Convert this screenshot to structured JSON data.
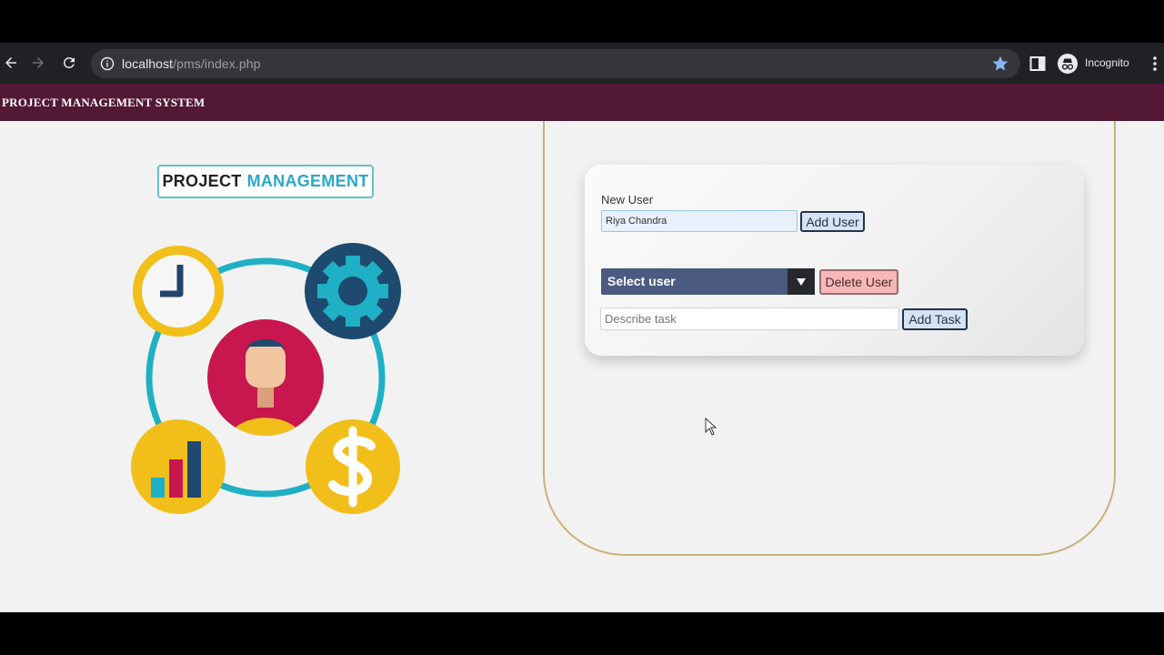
{
  "browser": {
    "url_host": "localhost",
    "url_path": "/pms/index.php",
    "profile_label": "Incognito"
  },
  "header": {
    "site_title": "PROJECT MANAGEMENT SYSTEM"
  },
  "logo": {
    "word1": "PROJECT",
    "word2": "MANAGEMENT"
  },
  "form": {
    "new_user_label": "New User",
    "new_user_value": "Riya Chandra",
    "add_user_button": "Add User",
    "select_user_value": "Select user",
    "delete_user_button": "Delete User",
    "task_placeholder": "Describe task",
    "add_task_button": "Add Task"
  },
  "colors": {
    "header_bg": "#521834",
    "accent_blue": "#29a8c8",
    "frame_gold": "#cbb27a",
    "select_bg": "#4a5a80"
  }
}
